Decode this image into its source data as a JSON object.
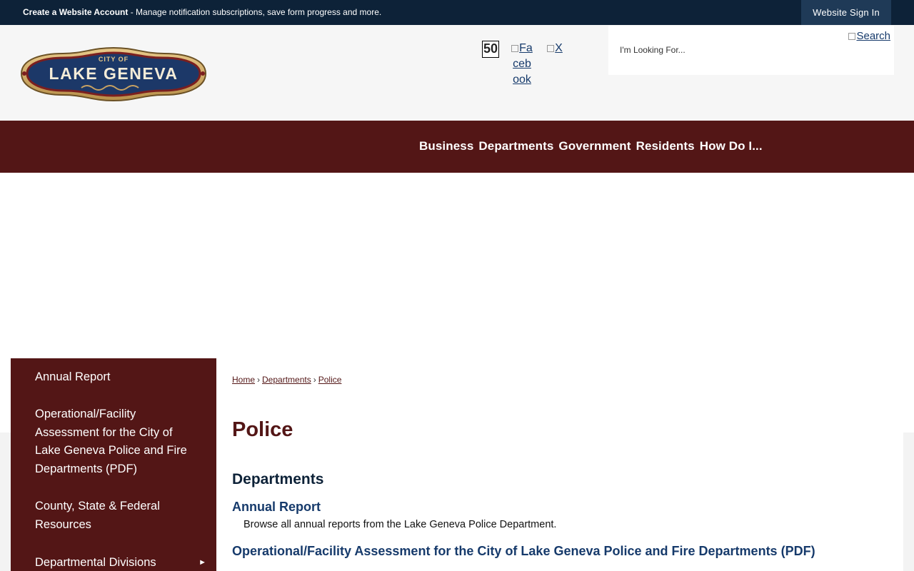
{
  "topbar": {
    "create_account": "Create a Website Account",
    "create_account_desc": " - Manage notification subscriptions, save form progress and more.",
    "sign_in": "Website Sign In"
  },
  "header": {
    "logo_small_text": "CITY OF",
    "logo_text": "LAKE GENEVA",
    "social": {
      "fifty_label": "50",
      "facebook_alt": "Facebook",
      "x_alt": "X"
    },
    "search": {
      "placeholder": "I'm Looking For...",
      "button_alt": "Search"
    }
  },
  "nav": {
    "items": [
      "Business",
      "Departments",
      "Government",
      "Residents",
      "How Do I..."
    ]
  },
  "sidebar": {
    "items": [
      {
        "label": "Annual Report"
      },
      {
        "label": "Operational/Facility Assessment for the City of Lake Geneva Police and Fire Departments (PDF)"
      },
      {
        "label": "County, State & Federal Resources"
      },
      {
        "label": "Departmental Divisions",
        "has_submenu": true
      }
    ],
    "arrow_icon": "right-triangle-icon"
  },
  "breadcrumb": [
    "Home",
    "Departments",
    "Police"
  ],
  "main": {
    "page_title": "Police",
    "section_title": "Departments",
    "entries": [
      {
        "title": "Annual Report",
        "description": "Browse all annual reports from the Lake Geneva Police Department."
      },
      {
        "title": "Operational/Facility Assessment for the City of Lake Geneva Police and Fire Departments (PDF)"
      }
    ]
  },
  "colors": {
    "topbar": "#0d2238",
    "accent_maroon": "#531616",
    "link_navy": "#163a6b"
  }
}
